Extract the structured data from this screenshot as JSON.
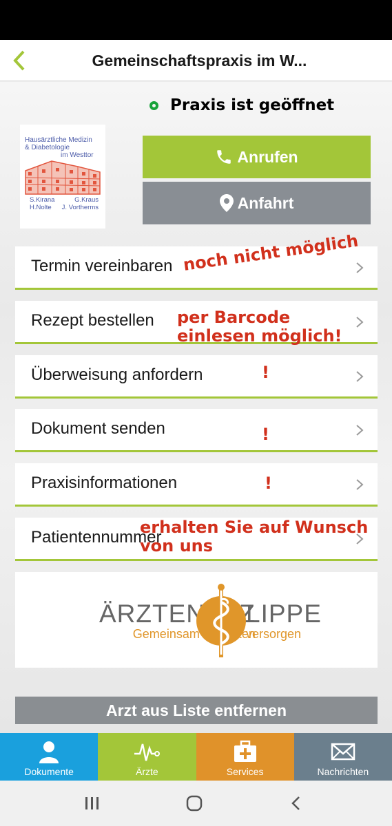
{
  "header": {
    "title": "Gemeinschaftspraxis im W..."
  },
  "status": {
    "text": "Praxis ist geöffnet",
    "color": "#18a33a"
  },
  "practice_logo": {
    "line1": "Hausärztliche Medizin",
    "line2": "& Diabetologie",
    "line3": "im Westtor",
    "names": [
      [
        "S.Kirana",
        "G.Kraus"
      ],
      [
        "H.Nolte",
        "J. Vortherms"
      ]
    ]
  },
  "actions": {
    "call": "Anrufen",
    "route": "Anfahrt"
  },
  "menu": [
    {
      "label": "Termin vereinbaren"
    },
    {
      "label": "Rezept bestellen"
    },
    {
      "label": "Überweisung anfordern"
    },
    {
      "label": "Dokument senden"
    },
    {
      "label": "Praxisinformationen"
    },
    {
      "label": "Patientennummer"
    }
  ],
  "annotations": {
    "termin": "noch nicht möglich",
    "rezept_1": "per Barcode",
    "rezept_2": "einlesen möglich!",
    "excl": "!",
    "patient_1": "erhalten Sie auf Wunsch",
    "patient_2": "von uns"
  },
  "partner": {
    "name_left": "ÄRZTENETZ",
    "name_right": "LIPPE",
    "sub_left": "Gemeinsam Patienten",
    "sub_right": "versorgen"
  },
  "remove_button": "Arzt aus Liste entfernen",
  "tabs": [
    {
      "label": "Dokumente",
      "icon": "person-icon",
      "color": "#1aa0dd"
    },
    {
      "label": "Ärzte",
      "icon": "heartbeat-icon",
      "color": "#a3c639"
    },
    {
      "label": "Services",
      "icon": "medical-case-icon",
      "color": "#e0922a"
    },
    {
      "label": "Nachrichten",
      "icon": "envelope-icon",
      "color": "#6b7f8d"
    }
  ]
}
